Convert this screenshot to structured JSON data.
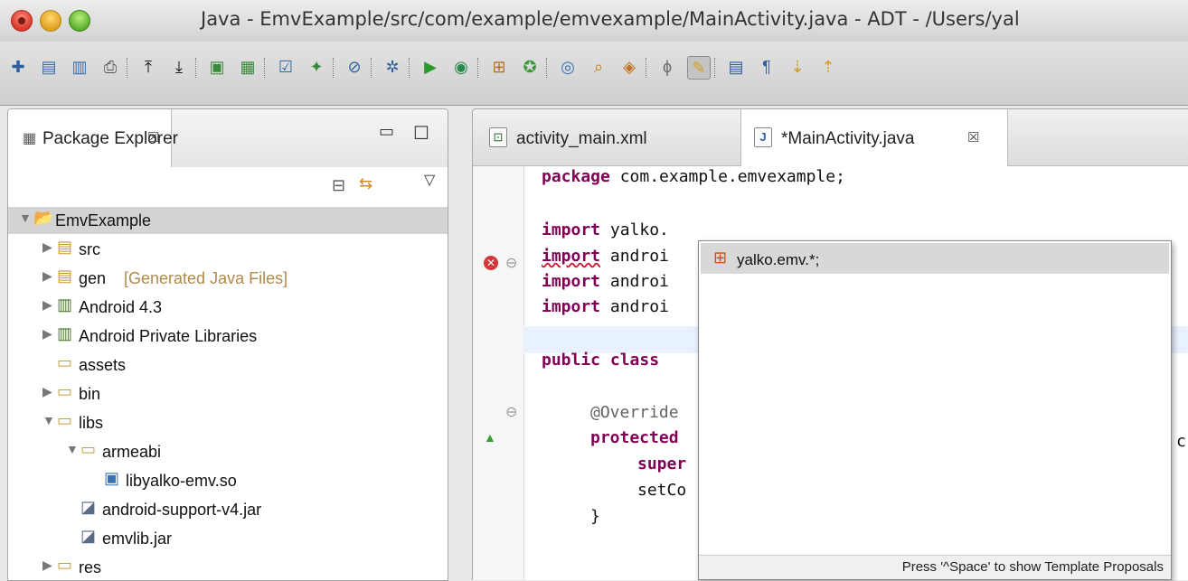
{
  "window": {
    "title": "Java - EmvExample/src/com/example/emvexample/MainActivity.java - ADT - /Users/yal"
  },
  "toolbar_icons": [
    "new-icon",
    "save-icon",
    "save-all-icon",
    "print-icon",
    "upload-icon",
    "download-icon",
    "android-sdk-manager-icon",
    "avd-manager-icon",
    "checkbox-icon",
    "new-android-project-icon",
    "skip-breakpoints-icon",
    "debug-icon",
    "run-icon",
    "external-tools-icon",
    "new-java-package-icon",
    "new-java-class-icon",
    "open-type-icon",
    "search-icon",
    "open-perspective-icon",
    "toggle-mark-occurrences-icon",
    "toggle-block-selection-icon",
    "show-whitespace-icon",
    "next-annotation-icon",
    "previous-annotation-icon",
    "back-icon"
  ],
  "package_explorer": {
    "tab_label": "Package Explorer",
    "tab_close": "☒",
    "tree": [
      {
        "label": "EmvExample",
        "depth": 0,
        "expanded": true,
        "selected": true,
        "icon": "android-project-icon"
      },
      {
        "label": "src",
        "depth": 1,
        "expanded": false,
        "icon": "source-folder-icon"
      },
      {
        "label": "gen",
        "decoration": "[Generated Java Files]",
        "depth": 1,
        "expanded": false,
        "icon": "generated-folder-icon"
      },
      {
        "label": "Android 4.3",
        "depth": 1,
        "expanded": false,
        "icon": "library-icon"
      },
      {
        "label": "Android Private Libraries",
        "depth": 1,
        "expanded": false,
        "icon": "library-icon"
      },
      {
        "label": "assets",
        "depth": 1,
        "leaf": true,
        "icon": "folder-icon"
      },
      {
        "label": "bin",
        "depth": 1,
        "expanded": false,
        "icon": "folder-icon"
      },
      {
        "label": "libs",
        "depth": 1,
        "expanded": true,
        "icon": "folder-icon"
      },
      {
        "label": "armeabi",
        "depth": 2,
        "expanded": true,
        "icon": "folder-icon"
      },
      {
        "label": "libyalko-emv.so",
        "depth": 3,
        "leaf": true,
        "icon": "binary-file-icon"
      },
      {
        "label": "android-support-v4.jar",
        "depth": 2,
        "leaf": true,
        "icon": "jar-icon"
      },
      {
        "label": "emvlib.jar",
        "depth": 2,
        "leaf": true,
        "icon": "jar-icon"
      },
      {
        "label": "res",
        "depth": 1,
        "expanded": false,
        "icon": "folder-icon"
      }
    ]
  },
  "editor": {
    "tabs": [
      {
        "label": "activity_main.xml",
        "active": false,
        "icon": "xml-file-icon"
      },
      {
        "label": "*MainActivity.java",
        "active": true,
        "icon": "java-file-icon",
        "close": "☒"
      }
    ],
    "code": {
      "l1_kw": "package",
      "l1_rest": " com.example.emvexample;",
      "l2_kw": "import",
      "l2_rest": " yalko.",
      "l3_kw": "import",
      "l3_rest": " androi",
      "l4_kw": "import",
      "l4_rest": " androi",
      "l5_kw": "import",
      "l5_rest": " androi",
      "l6_kw": "public class",
      "l6_rest": "",
      "l7": "@Override",
      "l8_kw": "protected",
      "l9_kw": "super",
      "l10": "setCo",
      "l11": "}",
      "overflow_char": "c"
    }
  },
  "autocomplete": {
    "proposals": [
      {
        "label": "yalko.emv.*;",
        "icon": "package-icon"
      }
    ],
    "status": "Press '^Space' to show Template Proposals"
  },
  "colors": {
    "keyword": "#7f0055",
    "current_line": "#e8f2fe",
    "selection": "#d3d3d3"
  }
}
